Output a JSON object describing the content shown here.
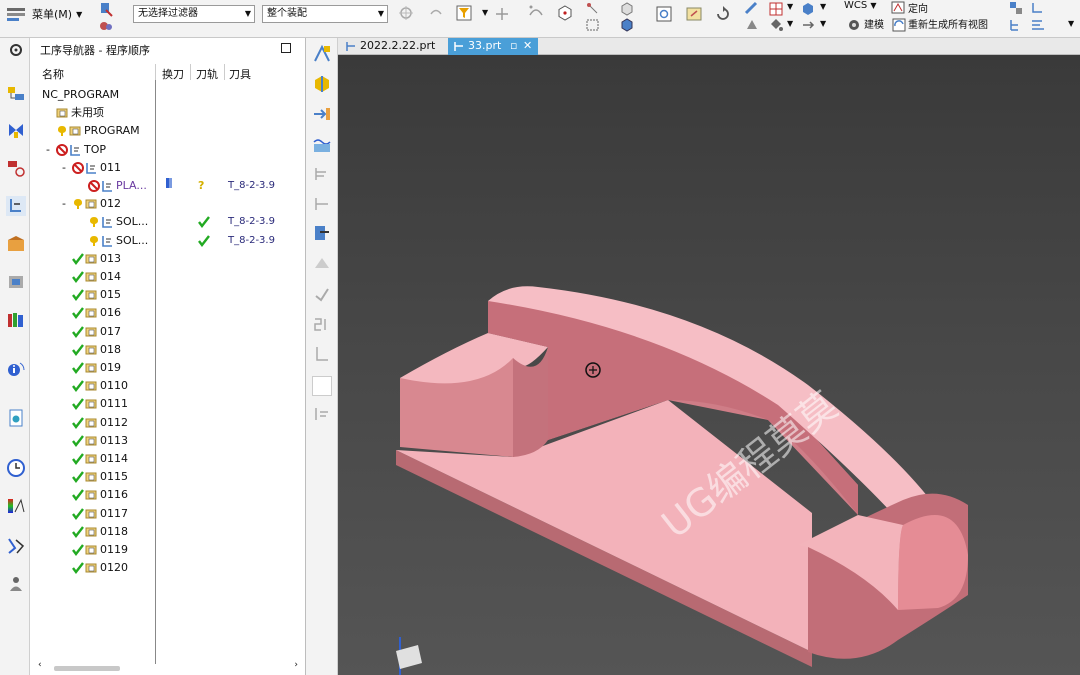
{
  "toolbar": {
    "menu_label": "菜单(M)",
    "filter_combo": "无选择过滤器",
    "assembly_combo": "整个装配",
    "wcs_label": "WCS",
    "orient_label": "定向",
    "build_label": "建模",
    "regen_label": "重新生成所有视图"
  },
  "navigator": {
    "title": "工序导航器 - 程序顺序",
    "columns": {
      "name": "名称",
      "tool_change": "换刀",
      "path": "刀轨",
      "tool": "刀具"
    },
    "rows": [
      {
        "label": "NC_PROGRAM",
        "indent": 0,
        "kind": "root",
        "tool": ""
      },
      {
        "label": "未用项",
        "indent": 1,
        "kind": "folder",
        "tool": ""
      },
      {
        "label": "PROGRAM",
        "indent": 1,
        "kind": "warn-folder",
        "tool": ""
      },
      {
        "label": "TOP",
        "indent": 1,
        "kind": "stop-folder",
        "expand": "-",
        "tool": ""
      },
      {
        "label": "011",
        "indent": 2,
        "kind": "stop-folder",
        "expand": "-",
        "tool": ""
      },
      {
        "label": "PLA...",
        "indent": 3,
        "kind": "stop-op",
        "tool": "T_8-2-3.9",
        "changer": true,
        "status": "?"
      },
      {
        "label": "012",
        "indent": 2,
        "kind": "warn-folder",
        "expand": "-",
        "tool": ""
      },
      {
        "label": "SOL...",
        "indent": 3,
        "kind": "warn-op",
        "tool": "T_8-2-3.9",
        "status": "ok"
      },
      {
        "label": "SOL...",
        "indent": 3,
        "kind": "warn-op",
        "tool": "T_8-2-3.9",
        "status": "ok"
      },
      {
        "label": "013",
        "indent": 2,
        "kind": "ok-folder",
        "tool": ""
      },
      {
        "label": "014",
        "indent": 2,
        "kind": "ok-folder",
        "tool": ""
      },
      {
        "label": "015",
        "indent": 2,
        "kind": "ok-folder",
        "tool": ""
      },
      {
        "label": "016",
        "indent": 2,
        "kind": "ok-folder",
        "tool": ""
      },
      {
        "label": "017",
        "indent": 2,
        "kind": "ok-folder",
        "tool": ""
      },
      {
        "label": "018",
        "indent": 2,
        "kind": "ok-folder",
        "tool": ""
      },
      {
        "label": "019",
        "indent": 2,
        "kind": "ok-folder",
        "tool": ""
      },
      {
        "label": "0110",
        "indent": 2,
        "kind": "ok-folder",
        "tool": ""
      },
      {
        "label": "0111",
        "indent": 2,
        "kind": "ok-folder",
        "tool": ""
      },
      {
        "label": "0112",
        "indent": 2,
        "kind": "ok-folder",
        "tool": ""
      },
      {
        "label": "0113",
        "indent": 2,
        "kind": "ok-folder",
        "tool": ""
      },
      {
        "label": "0114",
        "indent": 2,
        "kind": "ok-folder",
        "tool": ""
      },
      {
        "label": "0115",
        "indent": 2,
        "kind": "ok-folder",
        "tool": ""
      },
      {
        "label": "0116",
        "indent": 2,
        "kind": "ok-folder",
        "tool": ""
      },
      {
        "label": "0117",
        "indent": 2,
        "kind": "ok-folder",
        "tool": ""
      },
      {
        "label": "0118",
        "indent": 2,
        "kind": "ok-folder",
        "tool": ""
      },
      {
        "label": "0119",
        "indent": 2,
        "kind": "ok-folder",
        "tool": ""
      },
      {
        "label": "0120",
        "indent": 2,
        "kind": "ok-folder",
        "tool": ""
      }
    ]
  },
  "tabs": [
    {
      "label": "2022.2.22.prt",
      "active": false
    },
    {
      "label": "33.prt",
      "active": true
    }
  ],
  "viewport": {
    "watermark": "UG编程莫莫",
    "model_color": "#f2a5ae",
    "background": "#474747"
  },
  "colors": {
    "accent": "#4a9fd8",
    "ok": "#22aa22",
    "stop": "#cc1f1f",
    "warn": "#e8b800"
  }
}
